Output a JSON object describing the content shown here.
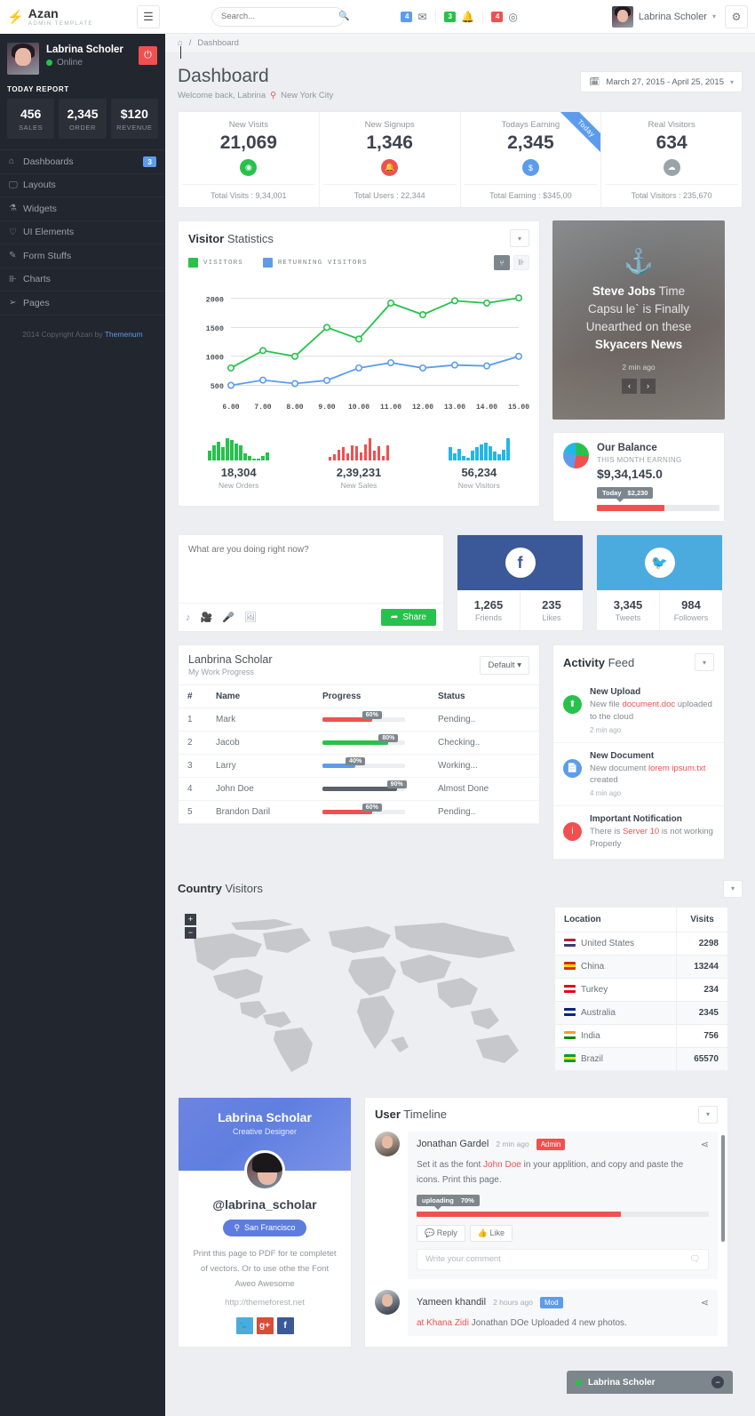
{
  "brand": {
    "name": "Azan",
    "subtitle": "ADMIN TEMPLATE",
    "bolt_icon": "bolt-icon",
    "toggle_icon": "hamburger-icon"
  },
  "sidebar": {
    "user": {
      "name": "Labrina Scholer",
      "status": "Online",
      "power_icon": "power-icon"
    },
    "today_report_label": "TODAY REPORT",
    "stats": [
      {
        "value": "456",
        "label": "SALES"
      },
      {
        "value": "2,345",
        "label": "ORDER"
      },
      {
        "value": "$120",
        "label": "REVENUE"
      }
    ],
    "items": [
      {
        "label": "Dashboards",
        "icon": "home-icon",
        "badge": "3"
      },
      {
        "label": "Layouts",
        "icon": "monitor-icon",
        "badge": ""
      },
      {
        "label": "Widgets",
        "icon": "flask-icon",
        "badge": ""
      },
      {
        "label": "UI Elements",
        "icon": "heart-icon",
        "badge": ""
      },
      {
        "label": "Form Stuffs",
        "icon": "pen-icon",
        "badge": ""
      },
      {
        "label": "Charts",
        "icon": "chart-icon",
        "badge": ""
      },
      {
        "label": "Pages",
        "icon": "paper-plane-icon",
        "badge": ""
      }
    ],
    "copyright_prefix": "2014 Copyright Azan by ",
    "copyright_link": "Themenum"
  },
  "header": {
    "search_placeholder": "Search...",
    "search_value": "",
    "search_icon": "search-icon",
    "notifications": [
      {
        "count": "4",
        "color": "#5d9cec",
        "icon": "envelope-icon"
      },
      {
        "count": "3",
        "color": "#27c24c",
        "icon": "bell-icon"
      },
      {
        "count": "4",
        "color": "#f05050",
        "icon": "clock-icon"
      }
    ],
    "user_name": "Labrina Scholer",
    "gear_icon": "gear-icon",
    "breadcrumb": [
      "home-icon",
      "/",
      "Dashboard"
    ]
  },
  "page": {
    "title": "Dashboard",
    "welcome": "Welcome back, Labrina",
    "location": "New York City",
    "location_icon": "map-pin-icon",
    "date_range": "March 27, 2015 - April 25, 2015",
    "calendar_icon": "calendar-icon"
  },
  "kpis": [
    {
      "label": "New Visits",
      "value": "21,069",
      "icon": "eye-icon",
      "color": "#27c24c",
      "footer": "Total Visits : 9,34,001"
    },
    {
      "label": "New Signups",
      "value": "1,346",
      "icon": "bell-icon",
      "color": "#f05050",
      "footer": "Total Users : 22,344"
    },
    {
      "label": "Todays Earning",
      "value": "2,345",
      "icon": "dollar-icon",
      "color": "#5d9cec",
      "footer": "Total Earning : $345,00",
      "ribbon": "Today"
    },
    {
      "label": "Real Visitors",
      "value": "634",
      "icon": "cloud-icon",
      "color": "#9aa3aa",
      "footer": "Total Visitors : 235,670"
    }
  ],
  "visitor_panel": {
    "title_bold": "Visitor",
    "title_rest": " Statistics",
    "legend": [
      {
        "label": "VISITORS",
        "color": "#27c24c"
      },
      {
        "label": "RETURNING VISITORS",
        "color": "#5d9cec"
      }
    ],
    "toggle_line_icon": "line-chart-icon",
    "toggle_bar_icon": "bar-chart-icon",
    "sparks": [
      {
        "value": "18,304",
        "label": "New Orders",
        "color": "#27c24c",
        "bars": [
          40,
          62,
          76,
          55,
          92,
          86,
          70,
          62,
          30,
          18,
          8,
          8,
          18,
          34
        ]
      },
      {
        "value": "2,39,231",
        "label": "New Sales",
        "color": "#f05050",
        "bars": [
          16,
          26,
          44,
          56,
          30,
          64,
          60,
          34,
          66,
          94,
          42,
          58,
          18,
          62
        ]
      },
      {
        "value": "56,234",
        "label": "New Visitors",
        "color": "#23b7e5",
        "bars": [
          56,
          30,
          48,
          18,
          12,
          40,
          56,
          66,
          74,
          60,
          36,
          26,
          44,
          92
        ]
      }
    ]
  },
  "chart_data": {
    "type": "line",
    "title": "Visitor Statistics",
    "xlabel": "",
    "ylabel": "",
    "x": [
      "6.00",
      "7.00",
      "8.00",
      "9.00",
      "10.00",
      "11.00",
      "12.00",
      "13.00",
      "14.00",
      "15.00"
    ],
    "ylim": [
      400,
      2150
    ],
    "yticks": [
      500,
      1000,
      1500,
      2000
    ],
    "grid": true,
    "legend_position": "top-left",
    "series": [
      {
        "name": "VISITORS",
        "color": "#27c24c",
        "values": [
          800,
          1100,
          1000,
          1500,
          1300,
          1920,
          1720,
          1960,
          1920,
          2010
        ]
      },
      {
        "name": "RETURNING VISITORS",
        "color": "#5d9cec",
        "values": [
          500,
          590,
          530,
          585,
          800,
          890,
          800,
          850,
          835,
          1000
        ]
      }
    ]
  },
  "news": {
    "anchor_icon": "anchor-icon",
    "line1_bold": "Steve Jobs",
    "line1_rest": " Time",
    "line2": "Capsu le` is Finally",
    "line3": "Unearthed on these",
    "line4_bold": "Skyacers News",
    "time": "2 min ago",
    "prev_icon": "chevron-left-icon",
    "next_icon": "chevron-right-icon"
  },
  "balance": {
    "pie_icon": "pie-chart-icon",
    "title": "Our Balance",
    "subtitle": "THIS MONTH EARNING",
    "amount": "$9,34,145.0",
    "tip_label": "Today",
    "tip_value": "$2,230",
    "progress_pct": 55
  },
  "compose": {
    "placeholder": "What are you doing right now?",
    "value": "",
    "icons": [
      "music-icon",
      "video-icon",
      "mic-icon",
      "image-icon"
    ],
    "share_label": "Share",
    "share_icon": "share-icon"
  },
  "social": [
    {
      "network": "facebook",
      "icon": "facebook-icon",
      "glyph": "f",
      "color": "#3b5998",
      "stats": [
        {
          "value": "1,265",
          "label": "Friends"
        },
        {
          "value": "235",
          "label": "Likes"
        }
      ]
    },
    {
      "network": "twitter",
      "icon": "twitter-icon",
      "glyph": "t",
      "color": "#4cabde",
      "stats": [
        {
          "value": "3,345",
          "label": "Tweets"
        },
        {
          "value": "984",
          "label": "Followers"
        }
      ]
    }
  ],
  "work_progress": {
    "title": "Lanbrina Scholar",
    "subtitle": "My Work Progress",
    "dropdown_label": "Default",
    "columns": [
      "#",
      "Name",
      "Progress",
      "Status"
    ],
    "rows": [
      {
        "num": "1",
        "name": "Mark",
        "pct": 60,
        "pct_label": "60%",
        "color": "#f05050",
        "status": "Pending.."
      },
      {
        "num": "2",
        "name": "Jacob",
        "pct": 80,
        "pct_label": "80%",
        "color": "#27c24c",
        "status": "Checking.."
      },
      {
        "num": "3",
        "name": "Larry",
        "pct": 40,
        "pct_label": "40%",
        "color": "#5d9cec",
        "status": "Working..."
      },
      {
        "num": "4",
        "name": "John Doe",
        "pct": 90,
        "pct_label": "90%",
        "color": "#5a6168",
        "status": "Almost Done"
      },
      {
        "num": "5",
        "name": "Brandon Daril",
        "pct": 60,
        "pct_label": "60%",
        "color": "#f05050",
        "status": "Pending.."
      }
    ]
  },
  "activity": {
    "title_bold": "Activity",
    "title_rest": " Feed",
    "items": [
      {
        "icon": "upload-icon",
        "color": "#27c24c",
        "title": "New Upload",
        "text_a": "New file ",
        "highlight": "document.doc",
        "text_b": " uploaded to the cloud",
        "time": "2 min ago"
      },
      {
        "icon": "file-icon",
        "color": "#5d9cec",
        "title": "New Document",
        "text_a": "New document ",
        "highlight": "lorem ipsum.txt",
        "text_b": " created",
        "time": "4 min ago"
      },
      {
        "icon": "info-icon",
        "color": "#f05050",
        "title": "Important Notification",
        "text_a": "There is ",
        "highlight": "Server 10",
        "text_b": " is not working Properly",
        "time": ""
      }
    ]
  },
  "country_visitors": {
    "title_bold": "Country",
    "title_rest": " Visitors",
    "zoom_in": "+",
    "zoom_out": "−",
    "columns": [
      "Location",
      "Visits"
    ],
    "rows": [
      {
        "country": "United States",
        "visits": "2298",
        "flag": "us-flag-icon",
        "c1": "#b22234",
        "c2": "#ffffff",
        "c3": "#3c3b6e"
      },
      {
        "country": "China",
        "visits": "13244",
        "flag": "china-flag-icon",
        "c1": "#de2910",
        "c2": "#ffde00",
        "c3": "#de2910"
      },
      {
        "country": "Turkey",
        "visits": "234",
        "flag": "turkey-flag-icon",
        "c1": "#e30a17",
        "c2": "#ffffff",
        "c3": "#e30a17"
      },
      {
        "country": "Australia",
        "visits": "2345",
        "flag": "australia-flag-icon",
        "c1": "#00247d",
        "c2": "#ffffff",
        "c3": "#00247d"
      },
      {
        "country": "India",
        "visits": "756",
        "flag": "india-flag-icon",
        "c1": "#ff9933",
        "c2": "#ffffff",
        "c3": "#138808"
      },
      {
        "country": "Brazil",
        "visits": "65570",
        "flag": "brazil-flag-icon",
        "c1": "#009b3a",
        "c2": "#fedf00",
        "c3": "#009b3a"
      }
    ]
  },
  "profile_card": {
    "name": "Labrina Scholar",
    "role": "Creative Designer",
    "handle": "@labrina_scholar",
    "location": "San Francisco",
    "location_icon": "map-pin-icon",
    "bio": "Print this page to PDF for te completet of vectors. Or to use othe the Font Aweo Awesome",
    "url": "http://themeforest.net",
    "socials": [
      {
        "icon": "twitter-icon",
        "glyph": "t",
        "color": "#4cabde"
      },
      {
        "icon": "google-plus-icon",
        "glyph": "g+",
        "color": "#dd4b39"
      },
      {
        "icon": "facebook-icon",
        "glyph": "f",
        "color": "#3b5998"
      }
    ]
  },
  "timeline": {
    "title_bold": "User",
    "title_rest": " Timeline",
    "posts": [
      {
        "author": "Jonathan Gardel",
        "time": "2 min ago",
        "tag": "Admin",
        "tag_color": "#f05050",
        "share_icon": "share-alt-icon",
        "text_a": "Set it as the font ",
        "highlight": "John Doe",
        "text_b": " in your applition, and copy and paste the icons. Print this page.",
        "upload_label": "uploading",
        "upload_pct_label": "70%",
        "upload_pct": 70,
        "reply_label": "Reply",
        "reply_icon": "comment-icon",
        "like_label": "Like",
        "like_icon": "thumbs-up-icon",
        "comment_placeholder": "Write your comment",
        "comment_icon": "comments-icon"
      },
      {
        "author": "Yameen khandil",
        "time": "2 hours ago",
        "tag": "Mod",
        "tag_color": "#5d9cec",
        "share_icon": "share-alt-icon",
        "text_a": "at ",
        "highlight": "Khana Zidi",
        "text_b": " Jonathan DOe Uploaded 4 new photos."
      }
    ]
  },
  "chatbar": {
    "name": "Labrina Scholer",
    "minimize_icon": "minus-icon"
  }
}
